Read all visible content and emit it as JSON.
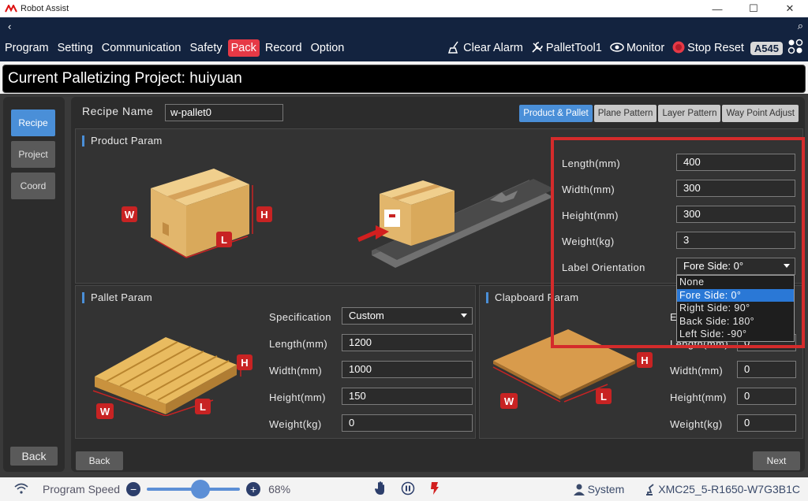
{
  "window": {
    "title": "Robot Assist",
    "minimize": "—",
    "maximize": "☐",
    "close": "✕"
  },
  "header": {
    "back_glyph": "‹",
    "search_glyph": "⌕"
  },
  "menu": {
    "items": [
      "Program",
      "Setting",
      "Communication",
      "Safety",
      "Pack",
      "Record",
      "Option"
    ],
    "active": "Pack"
  },
  "tools": {
    "clear_alarm": "Clear Alarm",
    "pallet_tool": "PalletTool1",
    "monitor": "Monitor",
    "stop_reset": "Stop Reset",
    "badge": "A545"
  },
  "project_bar": {
    "text": "Current Palletizing Project: huiyuan"
  },
  "sidebar": {
    "items": [
      "Recipe",
      "Project",
      "Coord"
    ],
    "active": "Recipe",
    "back": "Back"
  },
  "recipe": {
    "label": "Recipe Name",
    "value": "w-pallet0"
  },
  "tabs": {
    "items": [
      "Product & Pallet",
      "Plane Pattern",
      "Layer Pattern",
      "Way Point Adjust"
    ],
    "active": "Product & Pallet"
  },
  "product_param": {
    "title": "Product Param",
    "box_labels": {
      "w": "W",
      "h": "H",
      "l": "L"
    },
    "fields": [
      {
        "label": "Length(mm)",
        "value": "400"
      },
      {
        "label": "Width(mm)",
        "value": "300"
      },
      {
        "label": "Height(mm)",
        "value": "300"
      },
      {
        "label": "Weight(kg)",
        "value": "3"
      }
    ],
    "label_orientation": {
      "label": "Label Orientation",
      "selected": "Fore Side: 0°",
      "options": [
        "None",
        "Fore Side: 0°",
        "Right Side: 90°",
        "Back Side: 180°",
        "Left Side: -90°"
      ]
    }
  },
  "pallet_param": {
    "title": "Pallet Param",
    "labels": {
      "w": "W",
      "h": "H",
      "l": "L"
    },
    "specification": {
      "label": "Specification",
      "value": "Custom"
    },
    "fields": [
      {
        "label": "Length(mm)",
        "value": "1200"
      },
      {
        "label": "Width(mm)",
        "value": "1000"
      },
      {
        "label": "Height(mm)",
        "value": "150"
      },
      {
        "label": "Weight(kg)",
        "value": "0"
      }
    ]
  },
  "clapboard_param": {
    "title": "Clapboard Param",
    "labels": {
      "w": "W",
      "h": "H",
      "l": "L"
    },
    "partial_first_label": "E",
    "partial_length_label": "Length(mm)",
    "partial_length_value": "0",
    "fields": [
      {
        "label": "Width(mm)",
        "value": "0"
      },
      {
        "label": "Height(mm)",
        "value": "0"
      },
      {
        "label": "Weight(kg)",
        "value": "0"
      }
    ]
  },
  "footer_nav": {
    "back": "Back",
    "next": "Next"
  },
  "statusbar": {
    "program_speed_label": "Program Speed",
    "minus": "−",
    "plus": "+",
    "speed": "68%",
    "speed_fraction": 0.68,
    "user": "System",
    "device": "XMC25_5-R1650-W7G3B1C"
  },
  "colors": {
    "accent_blue": "#4a8fd8",
    "active_menu_red": "#e63946",
    "highlight_box": "#d42b2b",
    "header_navy": "#13233f"
  }
}
